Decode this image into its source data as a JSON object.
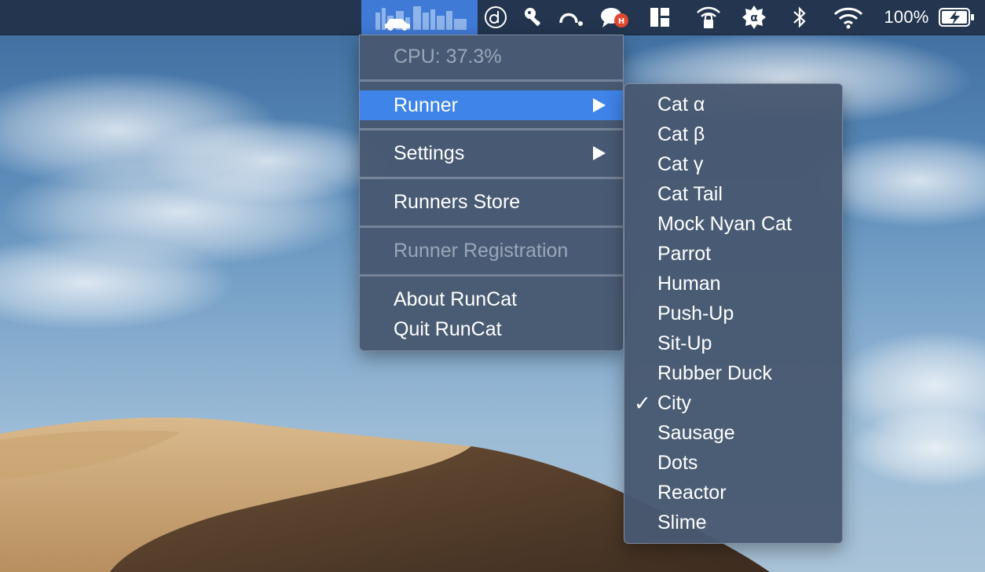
{
  "menubar": {
    "runcat_icon": "city-runner-icon",
    "icons": [
      "d-circle-icon",
      "key-icon",
      "headphones-icon",
      "chat-bubble-icon",
      "layout-icon",
      "wifi-lock-icon",
      "alpha-badge-icon",
      "bluetooth-icon",
      "wifi-icon"
    ],
    "battery_percent": "100%",
    "accent": "#3f7ad6"
  },
  "main_menu": {
    "cpu": "CPU: 37.3%",
    "runner": "Runner",
    "settings": "Settings",
    "runners_store": "Runners Store",
    "runner_registration": "Runner Registration",
    "about": "About RunCat",
    "quit": "Quit RunCat"
  },
  "runner_submenu": {
    "items": [
      "Cat α",
      "Cat β",
      "Cat γ",
      "Cat Tail",
      "Mock Nyan Cat",
      "Parrot",
      "Human",
      "Push-Up",
      "Sit-Up",
      "Rubber Duck",
      "City",
      "Sausage",
      "Dots",
      "Reactor",
      "Slime"
    ],
    "checked": "City",
    "check_mark": "✓"
  }
}
